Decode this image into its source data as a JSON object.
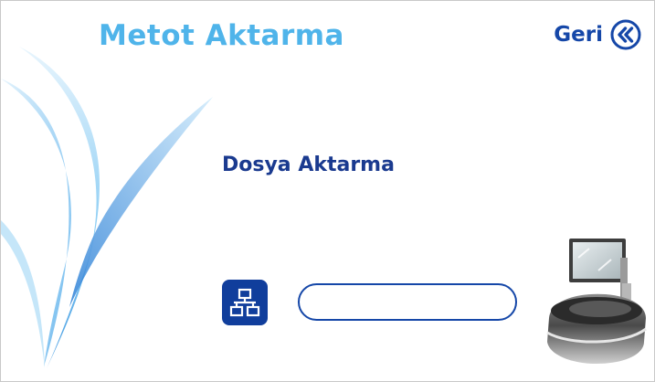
{
  "header": {
    "title": "Metot Aktarma",
    "back_label": "Geri"
  },
  "main": {
    "section_label": "Dosya Aktarma",
    "address_input": {
      "value": "",
      "placeholder": ""
    }
  },
  "icons": {
    "back": "double-chevron-left-icon",
    "network": "network-icon",
    "device": "instrument-device-image"
  },
  "colors": {
    "title": "#4fb4ea",
    "accent": "#1547a8",
    "label": "#1a3a8f",
    "network_tile": "#103e9c"
  }
}
